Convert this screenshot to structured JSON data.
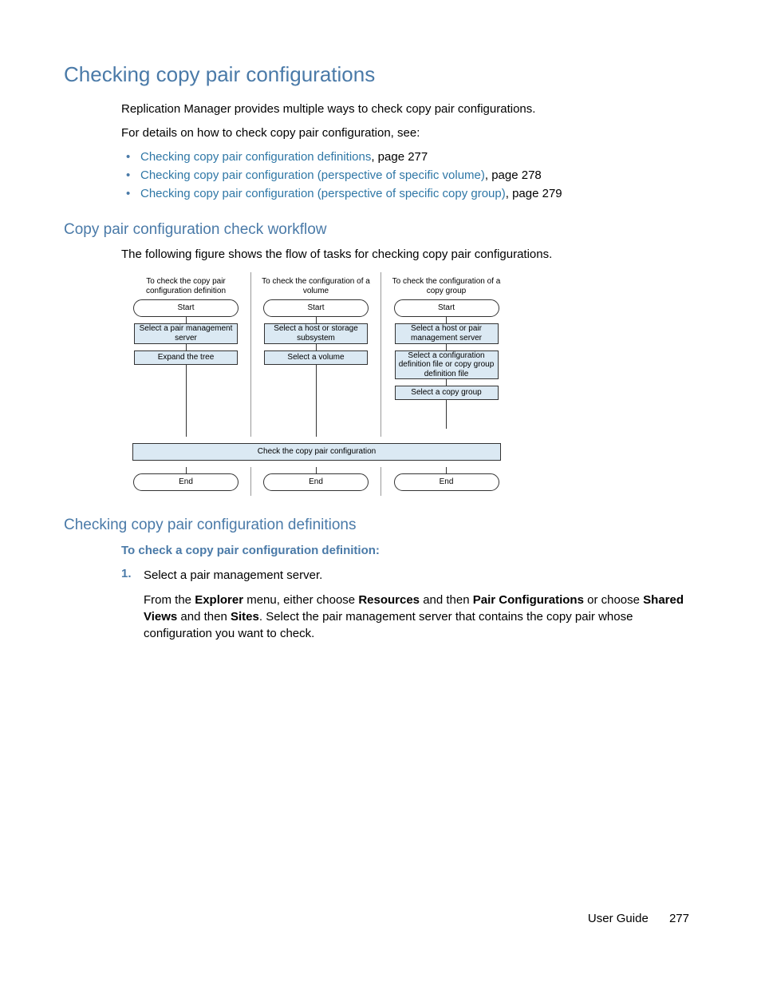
{
  "title": "Checking copy pair configurations",
  "intro1": "Replication Manager provides multiple ways to check copy pair configurations.",
  "intro2": "For details on how to check copy pair configuration, see:",
  "links": [
    {
      "text": "Checking copy pair configuration definitions",
      "page": ", page 277"
    },
    {
      "text": "Checking copy pair configuration (perspective of specific volume)",
      "page": ", page 278"
    },
    {
      "text": "Checking copy pair configuration (perspective of specific copy group)",
      "page": ", page 279"
    }
  ],
  "h2_workflow": "Copy pair configuration check workflow",
  "workflow_intro": "The following figure shows the flow of tasks for checking copy pair configurations.",
  "chart_data": {
    "type": "diagram",
    "columns": [
      {
        "header": "To check the copy pair configuration definition",
        "start": "Start",
        "steps": [
          "Select a pair management server",
          "Expand the tree"
        ],
        "end": "End"
      },
      {
        "header": "To check the configuration of a volume",
        "start": "Start",
        "steps": [
          "Select a host or storage subsystem",
          "Select a volume"
        ],
        "end": "End"
      },
      {
        "header": "To check the configuration of a copy group",
        "start": "Start",
        "steps": [
          "Select a host or pair management server",
          "Select a configuration definition file or copy group definition file",
          "Select a copy group"
        ],
        "end": "End"
      }
    ],
    "shared_step": "Check the copy pair configuration"
  },
  "h2_defs": "Checking copy pair configuration definitions",
  "proc_title": "To check a copy pair configuration definition:",
  "step1_num": "1.",
  "step1_text": "Select a pair management server.",
  "step1_para_a": "From the ",
  "step1_b1": "Explorer",
  "step1_para_b": " menu, either choose ",
  "step1_b2": "Resources",
  "step1_para_c": " and then ",
  "step1_b3": "Pair Configurations",
  "step1_para_d": " or choose ",
  "step1_b4": "Shared Views",
  "step1_para_e": " and then ",
  "step1_b5": "Sites",
  "step1_para_f": ". Select the pair management server that contains the copy pair whose configuration you want to check.",
  "footer_label": "User Guide",
  "footer_page": "277"
}
